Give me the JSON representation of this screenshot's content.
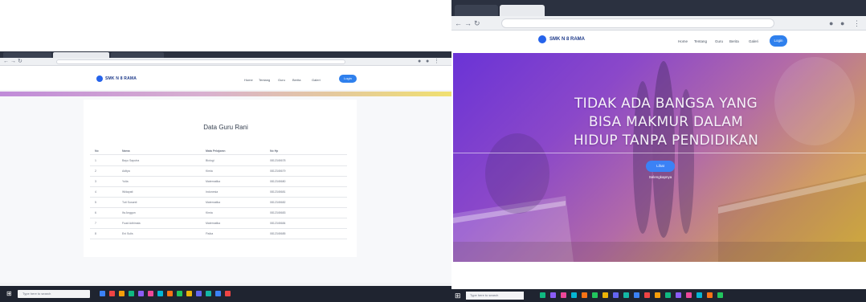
{
  "left_window": {
    "browser": {
      "tab_titles": [
        "",
        "",
        ""
      ],
      "url": ""
    },
    "site": {
      "logo_text": "SMK N 8 RAMA",
      "menu": [
        "Home",
        "Tentang",
        "Guru",
        "Berita",
        "Galeri"
      ],
      "login_label": "Login"
    },
    "page": {
      "heading": "Data Guru Rani",
      "table": {
        "headers": [
          "No",
          "Nama",
          "Mata Pelajaran",
          "No Hp"
        ],
        "rows": [
          [
            "1",
            "Bayu Saputra",
            "Biologi",
            "0812345678"
          ],
          [
            "2",
            "Aditya",
            "Kimia",
            "0812345679"
          ],
          [
            "3",
            "Yulia",
            "Matematika",
            "0812345680"
          ],
          [
            "4",
            "Widayati",
            "Indonesia",
            "0812345681"
          ],
          [
            "5",
            "Tuti Susanti",
            "Matematika",
            "0812345682"
          ],
          [
            "6",
            "Ifa Anggun",
            "Kimia",
            "0812345683"
          ],
          [
            "7",
            "Fuad Adhinata",
            "Matematika",
            "0812345684"
          ],
          [
            "8",
            "Eni Sulis",
            "Fisika",
            "0812345685"
          ]
        ]
      }
    },
    "taskbar": {
      "search_placeholder": "Type here to search",
      "clock": ""
    }
  },
  "right_window": {
    "browser": {
      "tab_titles": [
        "",
        ""
      ],
      "url": ""
    },
    "site": {
      "logo_text": "SMK N 8 RAMA",
      "menu": [
        "Home",
        "Tentang",
        "Guru",
        "Berita",
        "Galeri"
      ],
      "login_label": "Login"
    },
    "hero": {
      "lines": [
        "TIDAK ADA BANGSA YANG",
        "BISA MAKMUR DALAM",
        "HIDUP TANPA PENDIDIKAN"
      ],
      "cta_label": "Lihat Selengkapnya"
    },
    "taskbar": {
      "search_placeholder": "Type here to search",
      "clock": ""
    }
  },
  "colors": {
    "accent_blue": "#2f80ed",
    "hero_gradient_start": "#6a33d6",
    "hero_gradient_end": "#e2c040",
    "taskbar": "#1f2430",
    "titlebar": "#2b3140"
  }
}
